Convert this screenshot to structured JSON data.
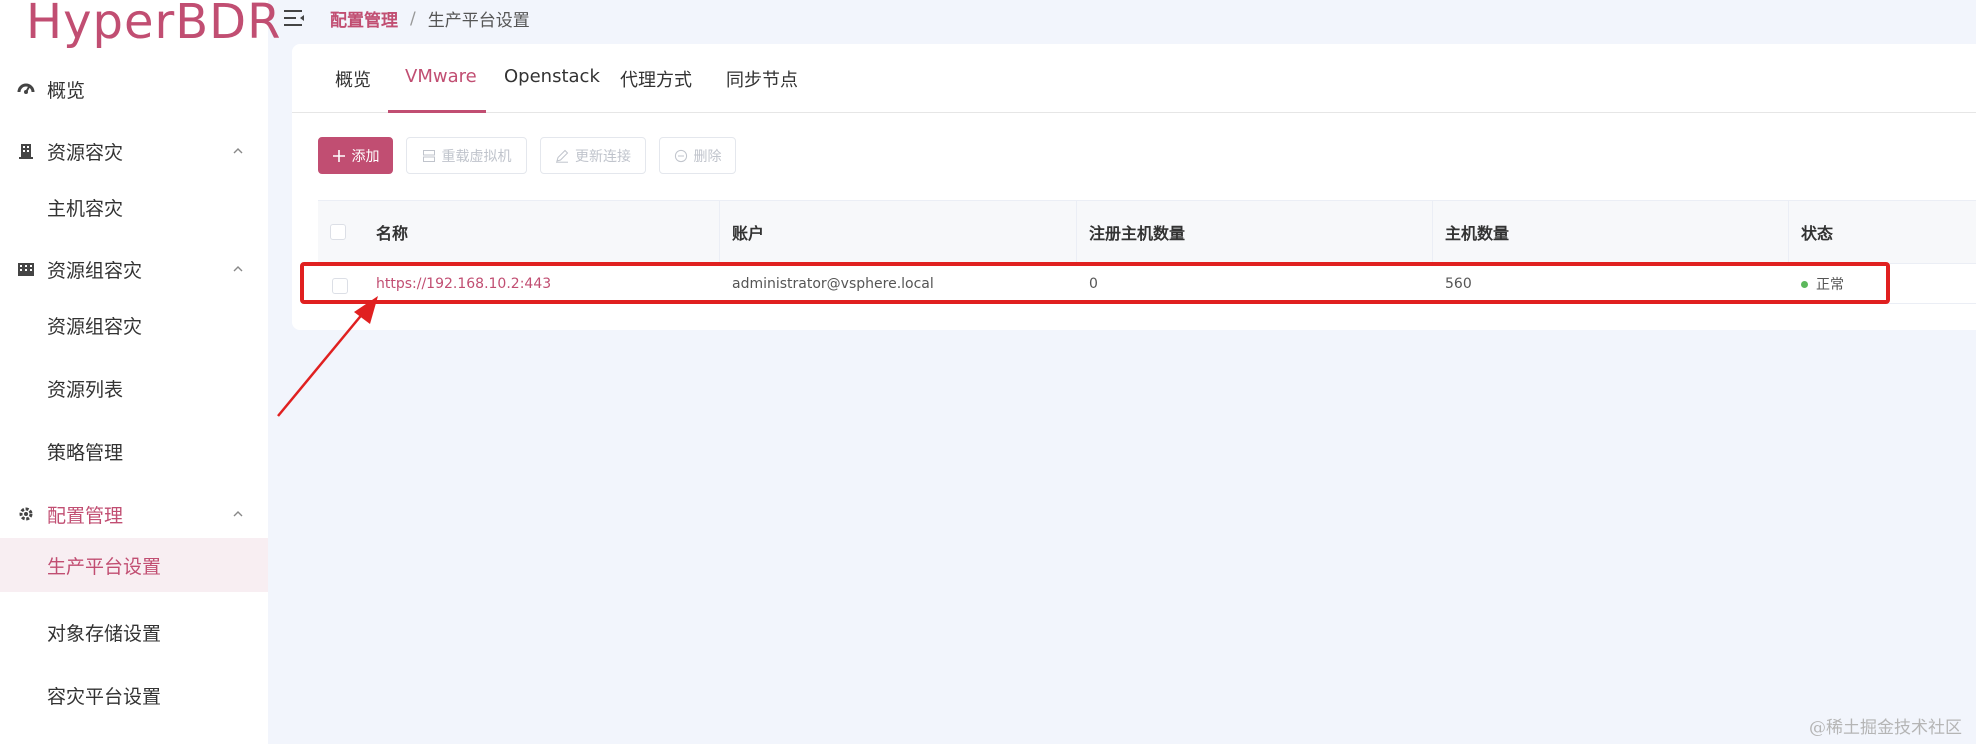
{
  "logo": "HyperBDR",
  "sidebar": {
    "items": [
      {
        "label": "概览",
        "icon": "dashboard-icon"
      },
      {
        "label": "资源容灾",
        "icon": "building-icon"
      },
      {
        "label": "主机容灾"
      },
      {
        "label": "资源组容灾",
        "icon": "buildings-icon"
      },
      {
        "label": "资源组容灾"
      },
      {
        "label": "资源列表"
      },
      {
        "label": "策略管理"
      },
      {
        "label": "配置管理",
        "icon": "gear-icon"
      },
      {
        "label": "生产平台设置"
      },
      {
        "label": "对象存储设置"
      },
      {
        "label": "容灾平台设置"
      }
    ]
  },
  "breadcrumb": {
    "parent": "配置管理",
    "separator": "/",
    "current": "生产平台设置"
  },
  "tabs": [
    "概览",
    "VMware",
    "Openstack",
    "代理方式",
    "同步节点"
  ],
  "active_tab": "VMware",
  "toolbar": {
    "add": "添加",
    "reload": "重载虚拟机",
    "update": "更新连接",
    "delete": "删除"
  },
  "table": {
    "headers": [
      "名称",
      "账户",
      "注册主机数量",
      "主机数量",
      "状态"
    ],
    "rows": [
      {
        "name": "https://192.168.10.2:443",
        "account": "administrator@vsphere.local",
        "registered": "0",
        "hosts": "560",
        "status": "正常"
      }
    ]
  },
  "colors": {
    "accent": "#c14e72",
    "highlight": "#e02020",
    "status_ok": "#5cb85c"
  },
  "watermark": "@稀土掘金技术社区"
}
